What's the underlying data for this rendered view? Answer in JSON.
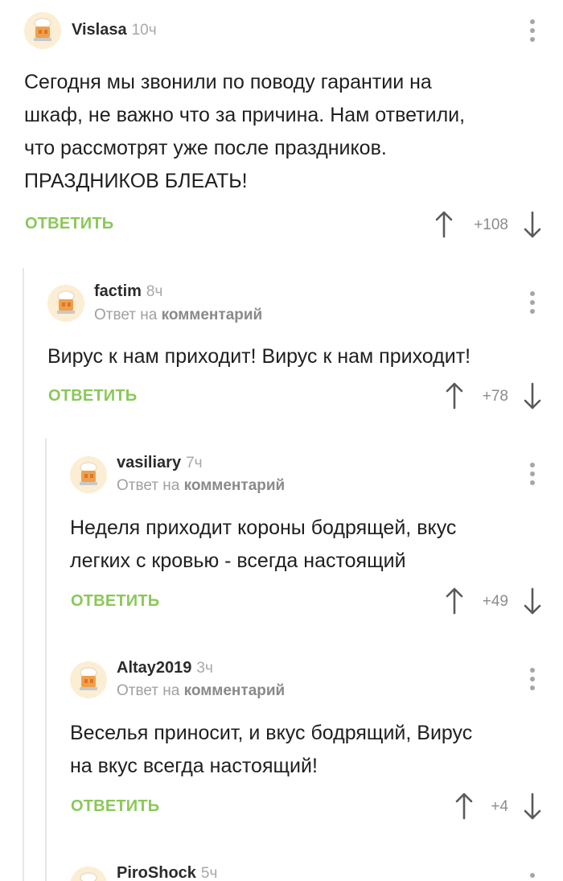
{
  "reply_label": "ОТВЕТИТЬ",
  "reply_to_prefix": "Ответ на",
  "reply_to_target": "комментарий",
  "comments": [
    {
      "user": "Vislasa",
      "time": "10ч",
      "lines": [
        "Сегодня мы звонили по поводу гарантии на",
        "шкаф, не важно что за причина. Нам ответили,",
        "что рассмотрят уже после праздников.",
        "ПРАЗДНИКОВ БЛЕАТЬ!"
      ],
      "score": "+108"
    },
    {
      "user": "factim",
      "time": "8ч",
      "lines": [
        "Вирус к нам приходит! Вирус к нам приходит!"
      ],
      "score": "+78"
    },
    {
      "user": "vasiliary",
      "time": "7ч",
      "lines": [
        "Неделя приходит короны бодрящей, вкус",
        "легких с кровью  - всегда настоящий"
      ],
      "score": "+49"
    },
    {
      "user": "Altay2019",
      "time": "3ч",
      "lines": [
        "Веселья приносит, и вкус бодрящий, Вирус",
        "на вкус всегда настоящий!"
      ],
      "score": "+4"
    },
    {
      "user": "PiroShock",
      "time": "5ч"
    }
  ]
}
